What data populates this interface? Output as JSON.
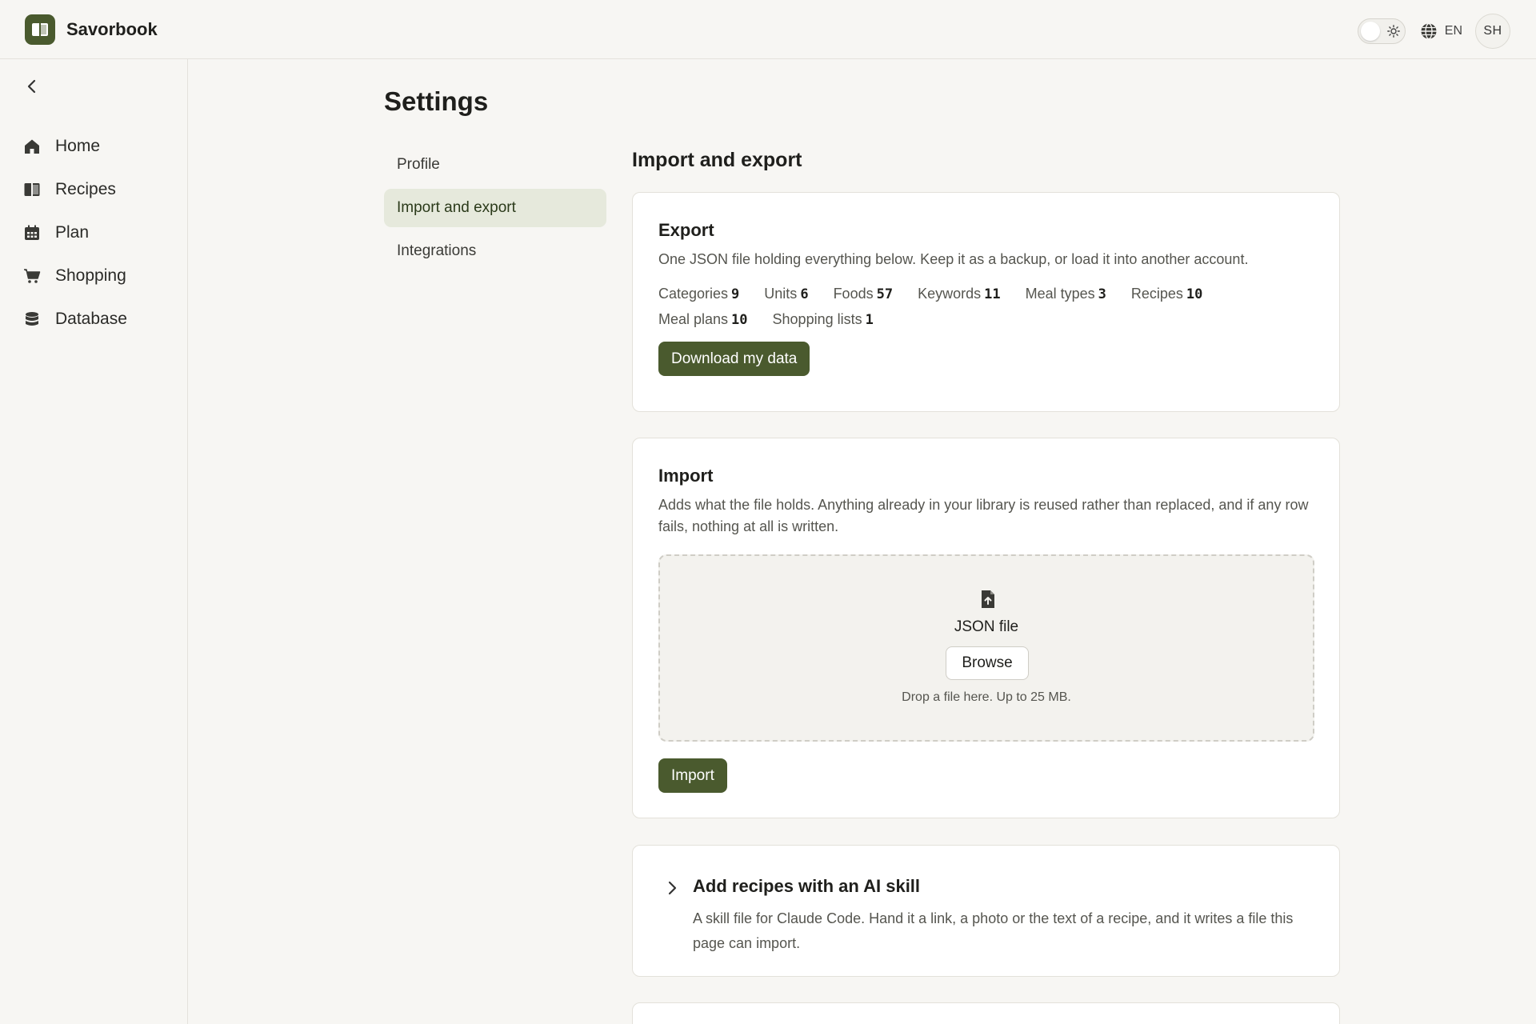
{
  "app": {
    "name": "Savorbook"
  },
  "topbar": {
    "language": "EN",
    "avatar_initials": "SH",
    "theme_icon": "sun-icon",
    "language_icon": "globe-icon"
  },
  "sidebar": {
    "items": [
      {
        "label": "Home",
        "icon": "home-icon"
      },
      {
        "label": "Recipes",
        "icon": "book-icon"
      },
      {
        "label": "Plan",
        "icon": "calendar-icon"
      },
      {
        "label": "Shopping",
        "icon": "cart-icon"
      },
      {
        "label": "Database",
        "icon": "database-icon"
      }
    ]
  },
  "page": {
    "title": "Settings"
  },
  "settings_nav": {
    "items": [
      {
        "label": "Profile",
        "active": false
      },
      {
        "label": "Import and export",
        "active": true
      },
      {
        "label": "Integrations",
        "active": false
      }
    ]
  },
  "section": {
    "title": "Import and export"
  },
  "export": {
    "title": "Export",
    "description": "One JSON file holding everything below. Keep it as a backup, or load it into another account.",
    "stats": [
      {
        "label": "Categories",
        "value": "9"
      },
      {
        "label": "Units",
        "value": "6"
      },
      {
        "label": "Foods",
        "value": "57"
      },
      {
        "label": "Keywords",
        "value": "11"
      },
      {
        "label": "Meal types",
        "value": "3"
      },
      {
        "label": "Recipes",
        "value": "10"
      },
      {
        "label": "Meal plans",
        "value": "10"
      },
      {
        "label": "Shopping lists",
        "value": "1"
      }
    ],
    "button": "Download my data"
  },
  "import": {
    "title": "Import",
    "description": "Adds what the file holds. Anything already in your library is reused rather than replaced, and if any row fails, nothing at all is written.",
    "dropzone": {
      "label": "JSON file",
      "browse": "Browse",
      "hint": "Drop a file here. Up to 25 MB."
    },
    "button": "Import"
  },
  "ai_skill": {
    "title": "Add recipes with an AI skill",
    "description": "A skill file for Claude Code. Hand it a link, a photo or the text of a recipe, and it writes a file this page can import."
  },
  "colors": {
    "accent": "#4a5a2e",
    "active_nav": "#e6e9dc",
    "background": "#f7f6f3"
  }
}
